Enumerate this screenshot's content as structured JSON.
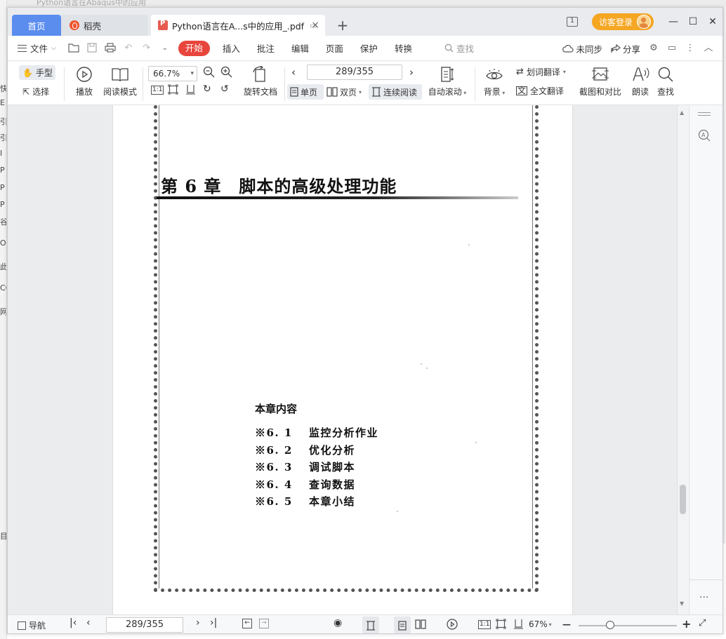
{
  "background": {
    "window_title": "Python语言在Abaqus中的应用",
    "edge_chars": [
      "快",
      "E",
      "引",
      "引",
      "I",
      "P",
      "P",
      "P",
      "谷",
      "Or",
      "此",
      "CC",
      "网",
      "目"
    ]
  },
  "tabs": {
    "home": "首页",
    "daoke": "稻壳",
    "document": "Python语言在A...s中的应用_.pdf",
    "add": "+",
    "close": "×"
  },
  "titlebar": {
    "pages_icon_label": "1",
    "login_label": "访客登录",
    "minimize": "—",
    "maximize": "☐",
    "close": "✕"
  },
  "menu": {
    "file": "文件",
    "start": "开始",
    "insert": "插入",
    "annotate": "批注",
    "edit": "编辑",
    "page": "页面",
    "protect": "保护",
    "convert": "转换",
    "search_placeholder": "查找",
    "sync": "未同步",
    "share": "分享"
  },
  "ribbon": {
    "hand_tool": "手型",
    "select_tool": "选择",
    "play": "播放",
    "read_mode": "阅读模式",
    "zoom_value": "66.7%",
    "rotate_doc": "旋转文档",
    "page_indicator": "289/355",
    "single_page": "单页",
    "double_page": "双页",
    "continuous": "连续阅读",
    "auto_scroll": "自动滚动",
    "background": "背景",
    "word_translate": "划词翻译",
    "full_translate": "全文翻译",
    "screenshot_compare": "截图和对比",
    "read_aloud": "朗读",
    "find": "查找",
    "actual_size": "1:1"
  },
  "page": {
    "chapter_title": "第 6 章　脚本的高级处理功能",
    "toc_heading": "本章内容",
    "toc_items": [
      "※6. 1　 监控分析作业",
      "※6. 2　 优化分析",
      "※6. 3　 调试脚本",
      "※6. 4　 查询数据",
      "※6. 5　 本章小结"
    ]
  },
  "statusbar": {
    "nav": "导航",
    "page_indicator": "289/355",
    "actual_size": "1:1",
    "zoom": "67%",
    "zoom_minus": "—",
    "zoom_plus": "+"
  },
  "colors": {
    "home_tab": "#5b8def",
    "start_menu": "#e8453c",
    "login_button": "#f5a623",
    "pdf_icon": "#e85a4f"
  }
}
